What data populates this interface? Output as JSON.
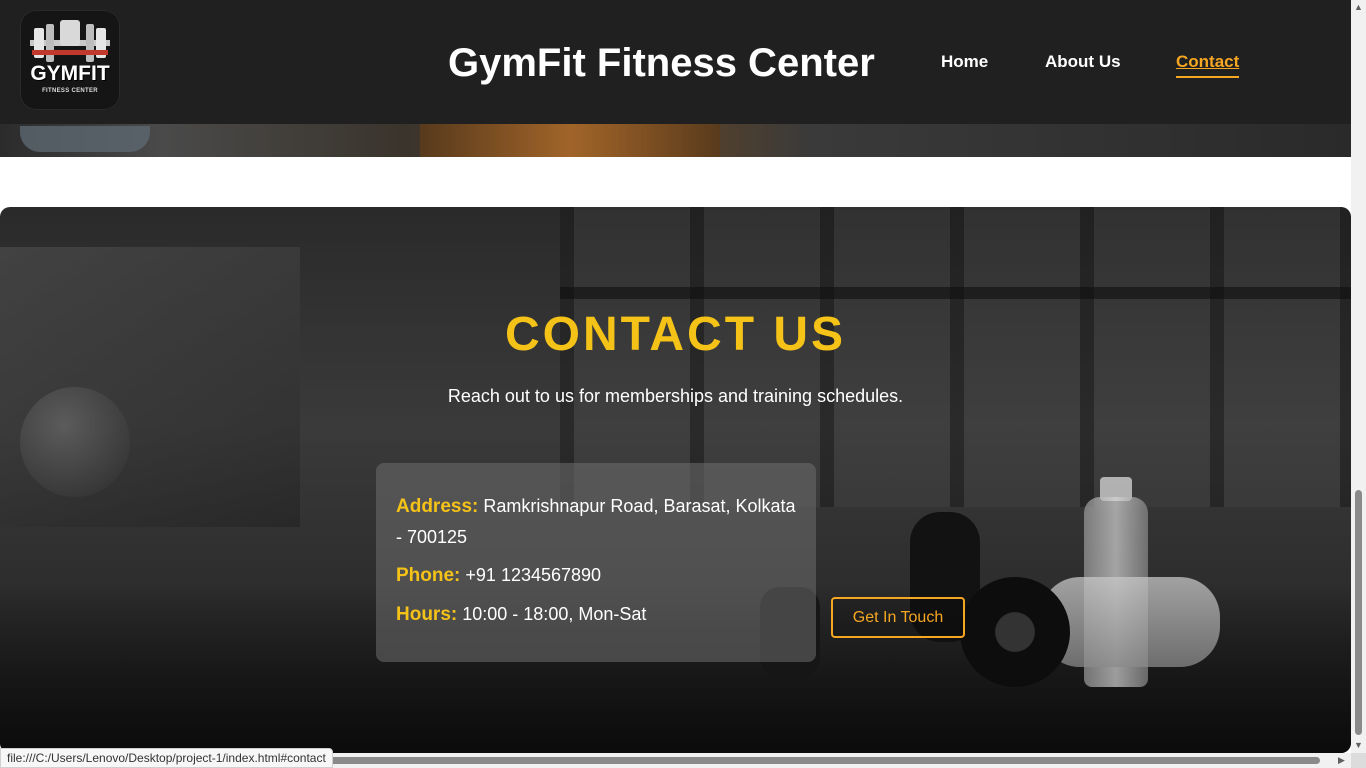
{
  "header": {
    "logo": {
      "brand": "GYMFIT",
      "tagline": "FITNESS CENTER",
      "icon": "barbell-logo-icon"
    },
    "title": "GymFit Fitness Center",
    "nav": [
      {
        "label": "Home",
        "active": false
      },
      {
        "label": "About Us",
        "active": false
      },
      {
        "label": "Contact",
        "active": true
      }
    ]
  },
  "contact": {
    "title": "CONTACT US",
    "subtitle": "Reach out to us for memberships and training schedules.",
    "address_label": "Address:",
    "address_value": "Ramkrishnapur Road, Barasat, Kolkata - 700125",
    "phone_label": "Phone:",
    "phone_value": "+91 1234567890",
    "hours_label": "Hours:",
    "hours_value": "10:00 - 18:00, Mon-Sat",
    "cta_label": "Get In Touch"
  },
  "status_bar": {
    "url": "file:///C:/Users/Lenovo/Desktop/project-1/index.html#contact"
  },
  "colors": {
    "header_bg": "#202020",
    "accent_gold": "#f5c218",
    "accent_orange": "#f5a623",
    "text_white": "#ffffff"
  }
}
